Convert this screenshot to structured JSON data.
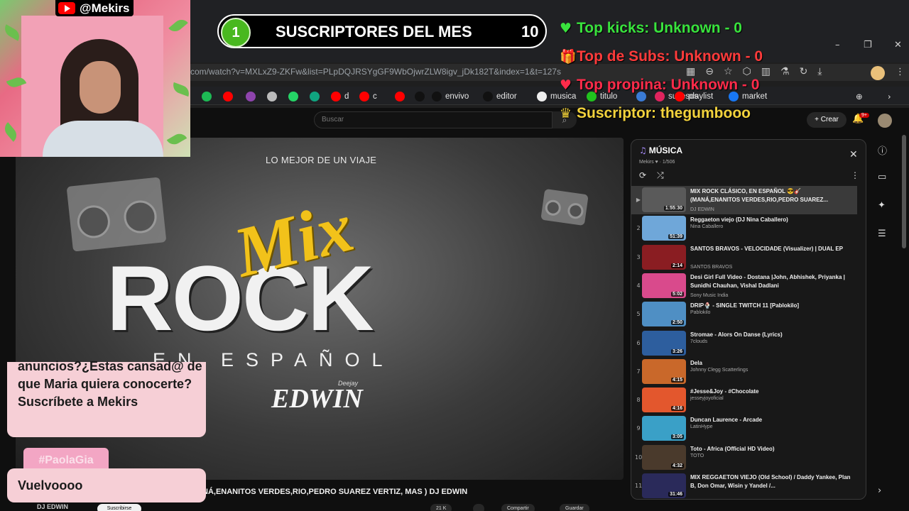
{
  "browser": {
    "url": "com/watch?v=MXLxZ9-ZKFw&list=PLpDQJRSYgGF9WbOjwrZLW8igv_jDk182T&index=1&t=127s",
    "window_controls": [
      "–",
      "❐",
      "✕"
    ],
    "bookmarks": [
      {
        "label": "",
        "color": "#1db954"
      },
      {
        "label": "",
        "color": "#ff0000"
      },
      {
        "label": "",
        "color": "#8e44ad"
      },
      {
        "label": "",
        "color": "#bbbbbb"
      },
      {
        "label": "",
        "color": "#25d366"
      },
      {
        "label": "",
        "color": "#10a37f"
      },
      {
        "label": "d",
        "color": "#ff0000"
      },
      {
        "label": "c",
        "color": "#ff0000"
      },
      {
        "label": "",
        "color": "#ff0000"
      },
      {
        "label": "",
        "color": "#111111"
      },
      {
        "label": "envivo",
        "color": "#111111"
      },
      {
        "label": "editor",
        "color": "#111111"
      },
      {
        "label": "musica",
        "color": "#eeeeee"
      },
      {
        "label": "titulo",
        "color": "#21c21e"
      },
      {
        "label": "",
        "color": "#3a7bd5"
      },
      {
        "label": "sucesos",
        "color": "#e0245e"
      },
      {
        "label": "playlist",
        "color": "#ff0000"
      },
      {
        "label": "market",
        "color": "#1877f2"
      }
    ]
  },
  "youtube": {
    "search_placeholder": "Buscar",
    "create_label": "Crear",
    "notifications": "9+",
    "video": {
      "overlay_subtitle": "LO MEJOR DE UN VIAJE",
      "art_mix": "Mix",
      "art_rock": "ROCK",
      "art_espanol": "EN ESPAÑOL",
      "art_edwin": "EDWIN",
      "art_deejay": "Deejay",
      "title_partial": "NÁ,ENANITOS VERDES,RIO,PEDRO SUAREZ VERTIZ, MAS ) DJ EDWIN",
      "channel": "DJ EDWIN",
      "subscribe_label": "Suscribirse",
      "actions": [
        "21 K",
        "",
        "Compartir",
        "Guardar"
      ]
    },
    "playlist": {
      "title": "MÚSICA",
      "meta": "Mekirs ♥ · 1/506",
      "items": [
        {
          "index": "▶",
          "title": "MIX ROCK CLÁSICO, EN ESPAÑOL 😎🎸 (MANÁ,ENANITOS VERDES,RIO,PEDRO SUAREZ...",
          "channel": "DJ EDWIN",
          "duration": "1:55:30",
          "thumb": "#5a5a5a",
          "current": true
        },
        {
          "index": "2",
          "title": "Reggaeton viejo (DJ Nina Caballero)",
          "channel": "Nina Caballero",
          "duration": "51:39",
          "thumb": "#6fa7d9"
        },
        {
          "index": "3",
          "title": "SANTOS BRAVOS - VELOCIDADE (Visualizer) | DUAL EP",
          "channel": "SANTOS BRAVOS",
          "duration": "2:14",
          "thumb": "#8a1d22"
        },
        {
          "index": "4",
          "title": "Desi Girl Full Video - Dostana |John, Abhishek, Priyanka | Sunidhi Chauhan, Vishal Dadlani",
          "channel": "Sony Music India",
          "duration": "5:02",
          "thumb": "#d94a8c"
        },
        {
          "index": "5",
          "title": "DRIP🍨 - SINGLE TWITCH 11 [Pablokilo]",
          "channel": "Pablokilo",
          "duration": "2:50",
          "thumb": "#4f8fc4"
        },
        {
          "index": "6",
          "title": "Stromae - Alors On Danse (Lyrics)",
          "channel": "7clouds",
          "duration": "3:26",
          "thumb": "#2d5e9e"
        },
        {
          "index": "7",
          "title": "Dela",
          "channel": "Johnny Clegg Scatterlings",
          "duration": "4:15",
          "thumb": "#c9682a"
        },
        {
          "index": "8",
          "title": "#Jesse&Joy - #Chocolate",
          "channel": "jesseyjoyoficial",
          "duration": "4:16",
          "thumb": "#e3572d"
        },
        {
          "index": "9",
          "title": "Duncan Laurence - Arcade",
          "channel": "LatinHype",
          "duration": "3:05",
          "thumb": "#3aa0c7"
        },
        {
          "index": "10",
          "title": "Toto - Africa (Official HD Video)",
          "channel": "TOTO",
          "duration": "4:32",
          "thumb": "#4a3a2c"
        },
        {
          "index": "11",
          "title": "MIX REGGAETON VIEJO (Old School) / Daddy Yankee, Plan B, Don Omar, Wisin y Yandel /...",
          "channel": "",
          "duration": "31:46",
          "thumb": "#2a2a5a"
        }
      ]
    }
  },
  "stream": {
    "handle": "@Mekirs",
    "goal": {
      "current": "1",
      "label": "SUSCRIPTORES DEL MES",
      "target": "10"
    },
    "stats": [
      {
        "icon": "green-heart-icon",
        "glyph": "♥",
        "text": "Top kicks: Unknown - 0",
        "color": "#39e33d"
      },
      {
        "icon": "gift-icon",
        "glyph": "🎁",
        "text": "Top de Subs: Unknown - 0",
        "color": "#ff3b3b"
      },
      {
        "icon": "heart-icon",
        "glyph": "♥",
        "text": "Top propina: Unknown - 0",
        "color": "#ff2b4a"
      },
      {
        "icon": "crown-icon",
        "glyph": "♛",
        "text": "Suscriptor: thegumbooo",
        "color": "#f2d23c"
      }
    ],
    "chat": {
      "promo_text": "anuncios?¿Estas cansad@ de que Maria quiera conocerte? Suscríbete a Mekirs",
      "username": "#PaolaGia",
      "message": "Vuelvoooo"
    }
  }
}
